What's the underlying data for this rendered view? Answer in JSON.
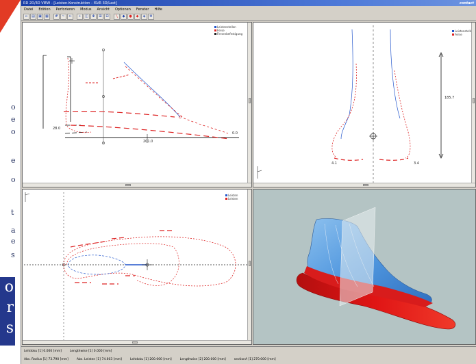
{
  "app": {
    "title": "RD 2D/3D VIEW - [Leisten-Konstruktion - ISVR 3D/Last]",
    "brand": "contact"
  },
  "menu": [
    "Datei",
    "Edition",
    "Perforieren",
    "Modus",
    "Ansicht",
    "Optionen",
    "Fenster",
    "Hilfe"
  ],
  "toolbar_icons": [
    "new-icon",
    "open-icon",
    "save-icon",
    "print-icon",
    "grid-icon",
    "curve-icon",
    "measure-icon",
    "zoom-icon",
    "zoom-box-icon",
    "pan-icon",
    "fit-icon",
    "align-icon",
    "line-icon",
    "3d-icon",
    "render-icon",
    "color-icon",
    "shade-icon",
    "settings-icon"
  ],
  "side_view": {
    "legend": [
      {
        "label": "Leistenstellen",
        "color": "#2255cc"
      },
      {
        "label": "Ferse",
        "color": "#dd2222"
      },
      {
        "label": "Fersenbefestigung",
        "color": "#222222"
      }
    ],
    "dims": {
      "left": "28.0",
      "bottom": "201.0",
      "end": "0.0"
    }
  },
  "rear_view": {
    "legend": [
      {
        "label": "Leistenstellen",
        "color": "#2255cc"
      },
      {
        "label": "Ferse",
        "color": "#dd2222"
      }
    ],
    "dims": {
      "height": "185.7",
      "left": "4.1",
      "right": "3.4"
    }
  },
  "top_view": {
    "legend": [
      {
        "label": "Leisten",
        "color": "#2255cc"
      },
      {
        "label": "Leisten",
        "color": "#dd2222"
      }
    ]
  },
  "colors": {
    "blue": "#2255cc",
    "red": "#dd2222",
    "model_blue": "#4f96de",
    "model_red": "#e01515",
    "bg3d": "#b4c4c4"
  },
  "status": {
    "row1": [
      "Leitdoku [1]    0.000 [mm]",
      "Lengthwise [1]    0.000 [mm]"
    ],
    "row2": [
      "Abs. Radius [1]    73.790 [mm]",
      "Abs. Leisten [1]    74.603 [mm]",
      "Leitdoku [1]    200.000 [mm]",
      "Lengthwise [2]    200.000 [mm]",
      "sectionA [1]    270.000 [mm]"
    ]
  },
  "backdrop": {
    "fragments": [
      "o",
      "e",
      "o",
      "e",
      "o",
      "t",
      "a",
      "e",
      "s"
    ],
    "block_text": [
      "o",
      "r",
      "s"
    ]
  }
}
